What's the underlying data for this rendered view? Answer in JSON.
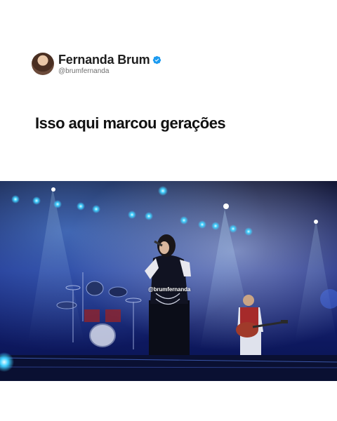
{
  "post": {
    "author": {
      "display_name": "Fernanda Brum",
      "handle": "@brumfernanda",
      "verified": true,
      "avatar_icon": "avatar-photo"
    },
    "caption": "Isso aqui marcou gerações",
    "media": {
      "kind": "concert-photo",
      "watermark": "@brumfernanda"
    }
  },
  "colors": {
    "verified_badge": "#1d9bf0",
    "stage_light": "#3fd0ff",
    "background": "#ffffff"
  }
}
